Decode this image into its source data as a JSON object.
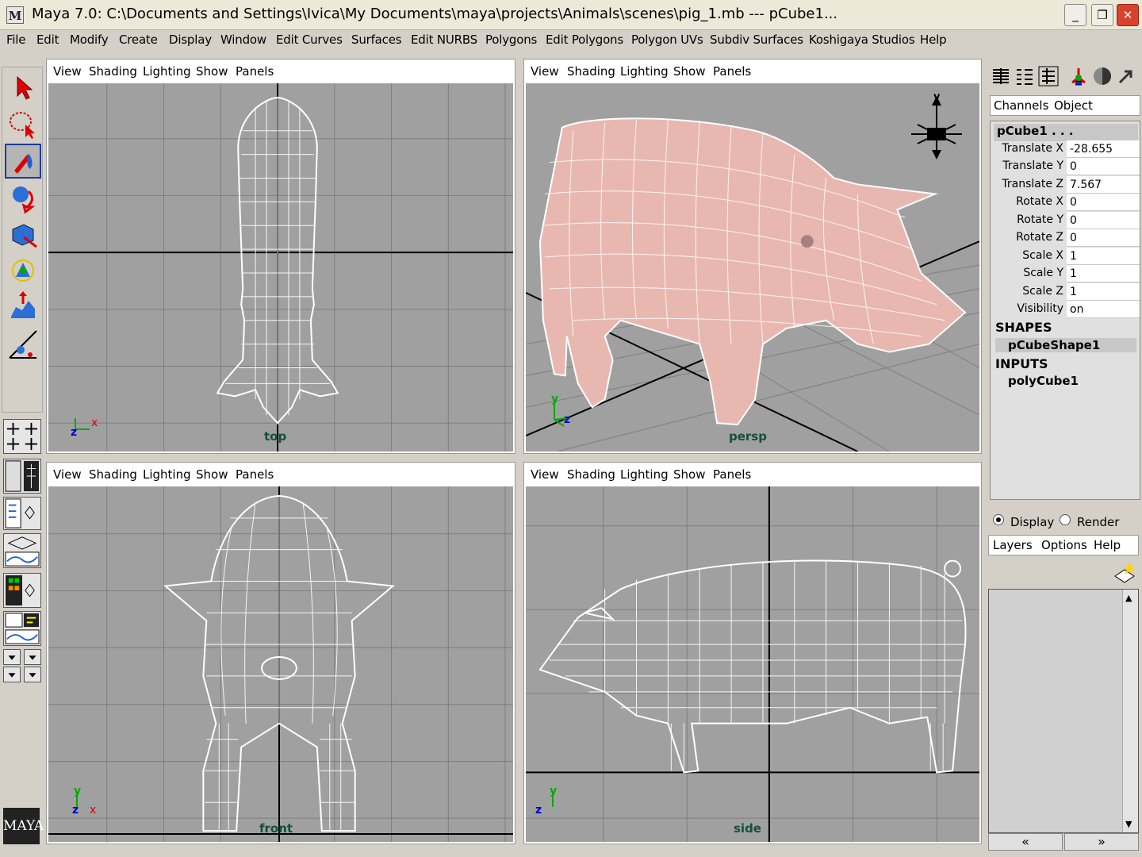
{
  "window": {
    "title": "Maya 7.0: C:\\Documents and Settings\\Ivica\\My Documents\\maya\\projects\\Animals\\scenes\\pig_1.mb   ---   pCube1...",
    "app_icon": "M",
    "minimize": "_",
    "maximize": "❐",
    "close": "✕"
  },
  "menubar": [
    "File",
    "Edit",
    "Modify",
    "Create",
    "Display",
    "Window",
    "Edit Curves",
    "Surfaces",
    "Edit NURBS",
    "Polygons",
    "Edit Polygons",
    "Polygon UVs",
    "Subdiv Surfaces",
    "Koshigaya Studios",
    "Help"
  ],
  "panel_menu": [
    "View",
    "Shading",
    "Lighting",
    "Show",
    "Panels"
  ],
  "panels": {
    "top": {
      "camera": "top",
      "axis_a": "x",
      "axis_b": "z"
    },
    "persp": {
      "camera": "persp",
      "axis_a": "y",
      "axis_b": "z"
    },
    "front": {
      "camera": "front",
      "axis_a": "y",
      "axis_b": "z",
      "axis_c": "x"
    },
    "side": {
      "camera": "side",
      "axis_a": "y",
      "axis_b": "z"
    }
  },
  "view_cube_label": "y",
  "channel_box": {
    "tabs": [
      "Channels",
      "Object"
    ],
    "object": "pCube1 . . .",
    "attributes": [
      {
        "label": "Translate X",
        "value": "-28.655"
      },
      {
        "label": "Translate Y",
        "value": "0"
      },
      {
        "label": "Translate Z",
        "value": "7.567"
      },
      {
        "label": "Rotate X",
        "value": "0"
      },
      {
        "label": "Rotate Y",
        "value": "0"
      },
      {
        "label": "Rotate Z",
        "value": "0"
      },
      {
        "label": "Scale X",
        "value": "1"
      },
      {
        "label": "Scale Y",
        "value": "1"
      },
      {
        "label": "Scale Z",
        "value": "1"
      },
      {
        "label": "Visibility",
        "value": "on"
      }
    ],
    "shapes_heading": "SHAPES",
    "shape_node": "pCubeShape1",
    "inputs_heading": "INPUTS",
    "input_node": "polyCube1"
  },
  "layer_editor": {
    "display_option": "Display",
    "render_option": "Render",
    "menu": [
      "Layers",
      "Options",
      "Help"
    ],
    "scroll_left": "«",
    "scroll_right": "»"
  },
  "logo": "MAYA"
}
